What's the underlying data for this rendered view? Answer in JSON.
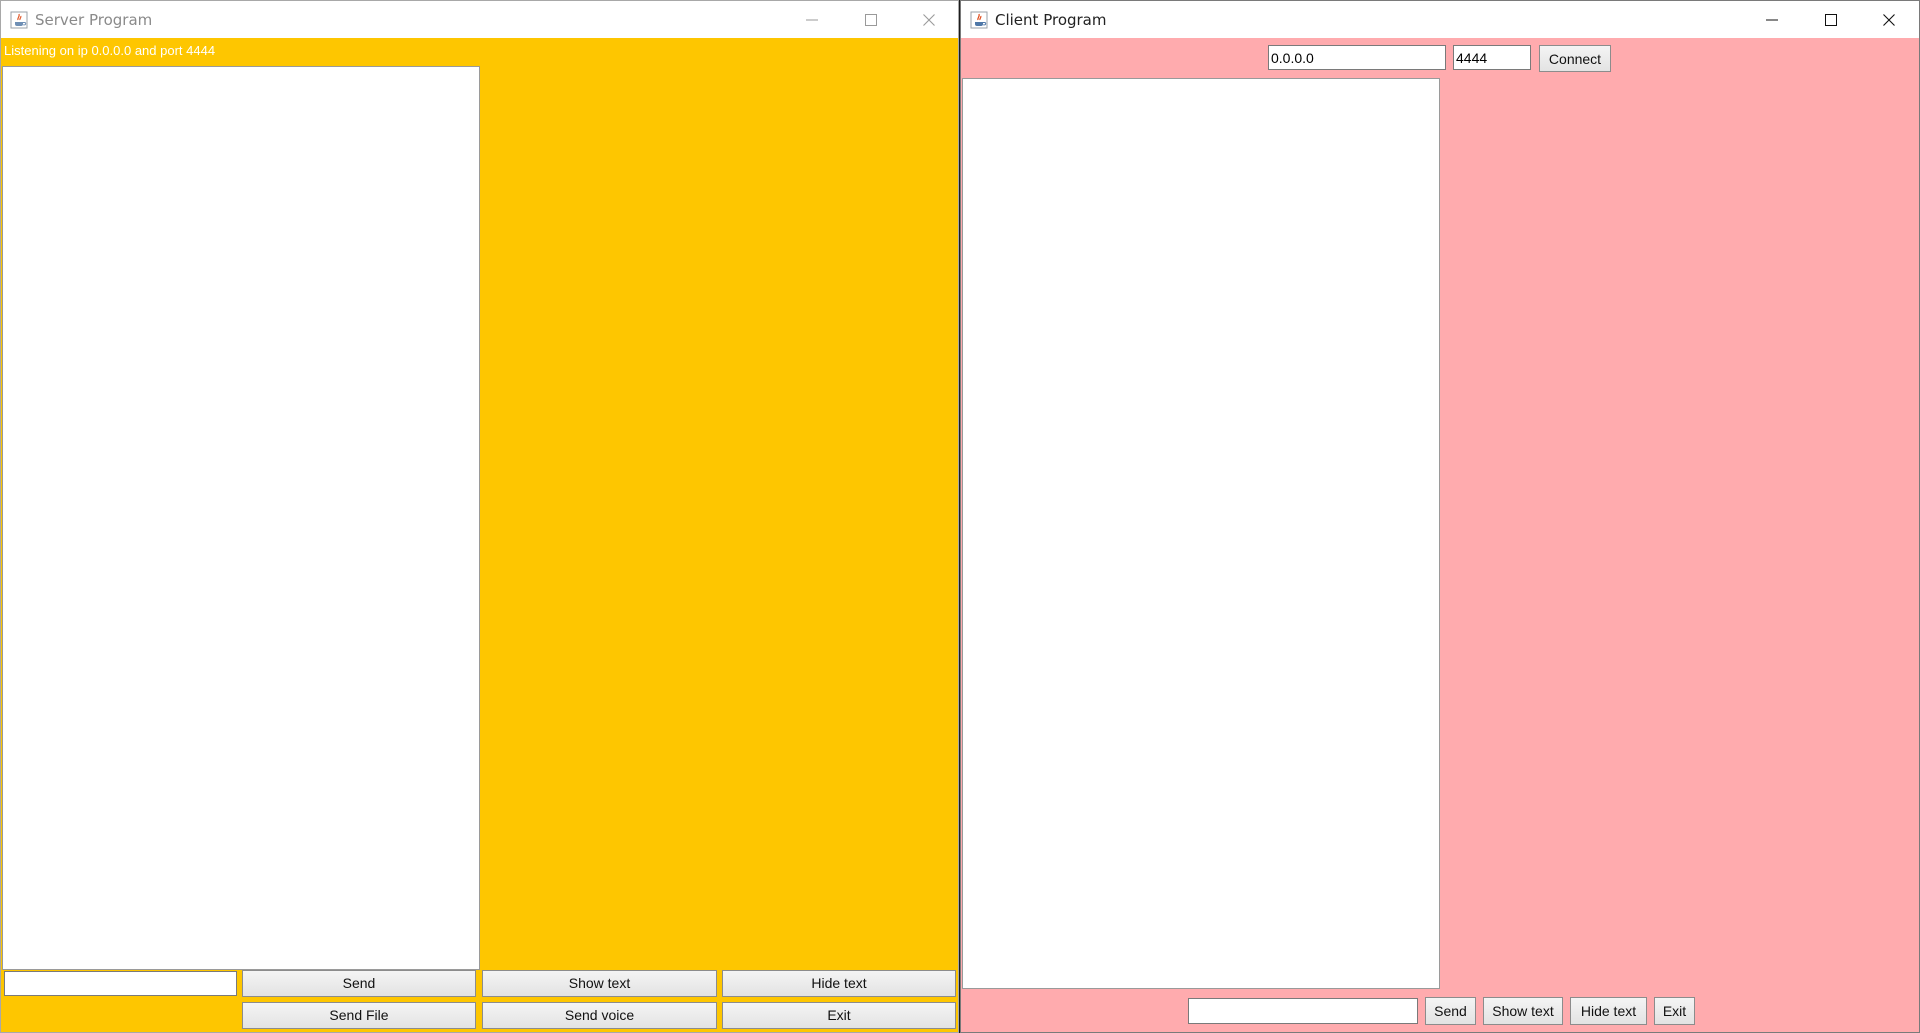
{
  "server": {
    "title": "Server Program",
    "status": "Listening on ip 0.0.0.0 and port 4444",
    "message_input": {
      "value": ""
    },
    "buttons": {
      "send": "Send",
      "show_text": "Show text",
      "hide_text": "Hide text",
      "send_file": "Send File",
      "send_voice": "Send voice",
      "exit": "Exit"
    }
  },
  "client": {
    "title": "Client Program",
    "ip_input": {
      "value": "0.0.0.0"
    },
    "port_input": {
      "value": "4444"
    },
    "buttons": {
      "connect": "Connect",
      "send": "Send",
      "show_text": "Show text",
      "hide_text": "Hide text",
      "exit": "Exit"
    },
    "message_input": {
      "value": ""
    }
  },
  "colors": {
    "server_background": "#fec600",
    "client_background": "#ffabae",
    "status_text": "#ffffff"
  },
  "icons": {
    "app": "java-app-icon",
    "minimize": "minimize-icon",
    "maximize": "maximize-icon",
    "close": "close-icon"
  }
}
